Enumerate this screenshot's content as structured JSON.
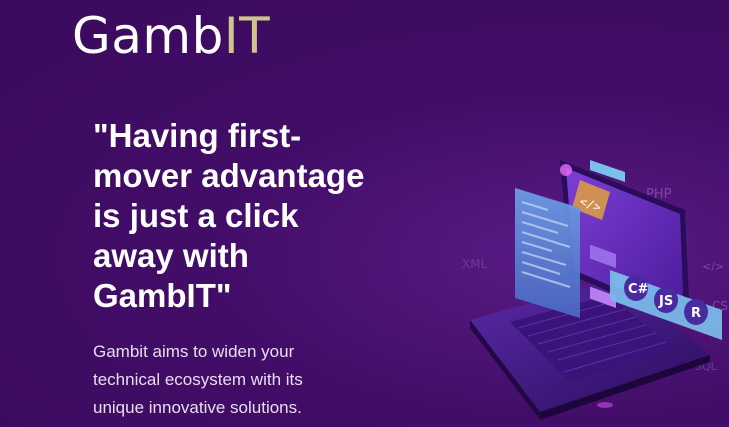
{
  "brand": {
    "name_main": "Gamb",
    "name_accent": "IT"
  },
  "hero": {
    "headline": "\"Having first-\nmover advantage\nis just a    click\naway with\nGambIT\"",
    "subtext": "Gambit aims to widen your technical ecosystem with its unique innovative solutions."
  },
  "illustration": {
    "badges": [
      "C#",
      "JS",
      "R"
    ],
    "code_tags": [
      "PHP",
      "XML",
      "</>",
      "CS",
      "SQL"
    ],
    "colors": {
      "screen": "#6a2bc0",
      "panel": "#5d8bd6",
      "badge": "#7ab8e8",
      "glow": "#c94cf0"
    }
  }
}
